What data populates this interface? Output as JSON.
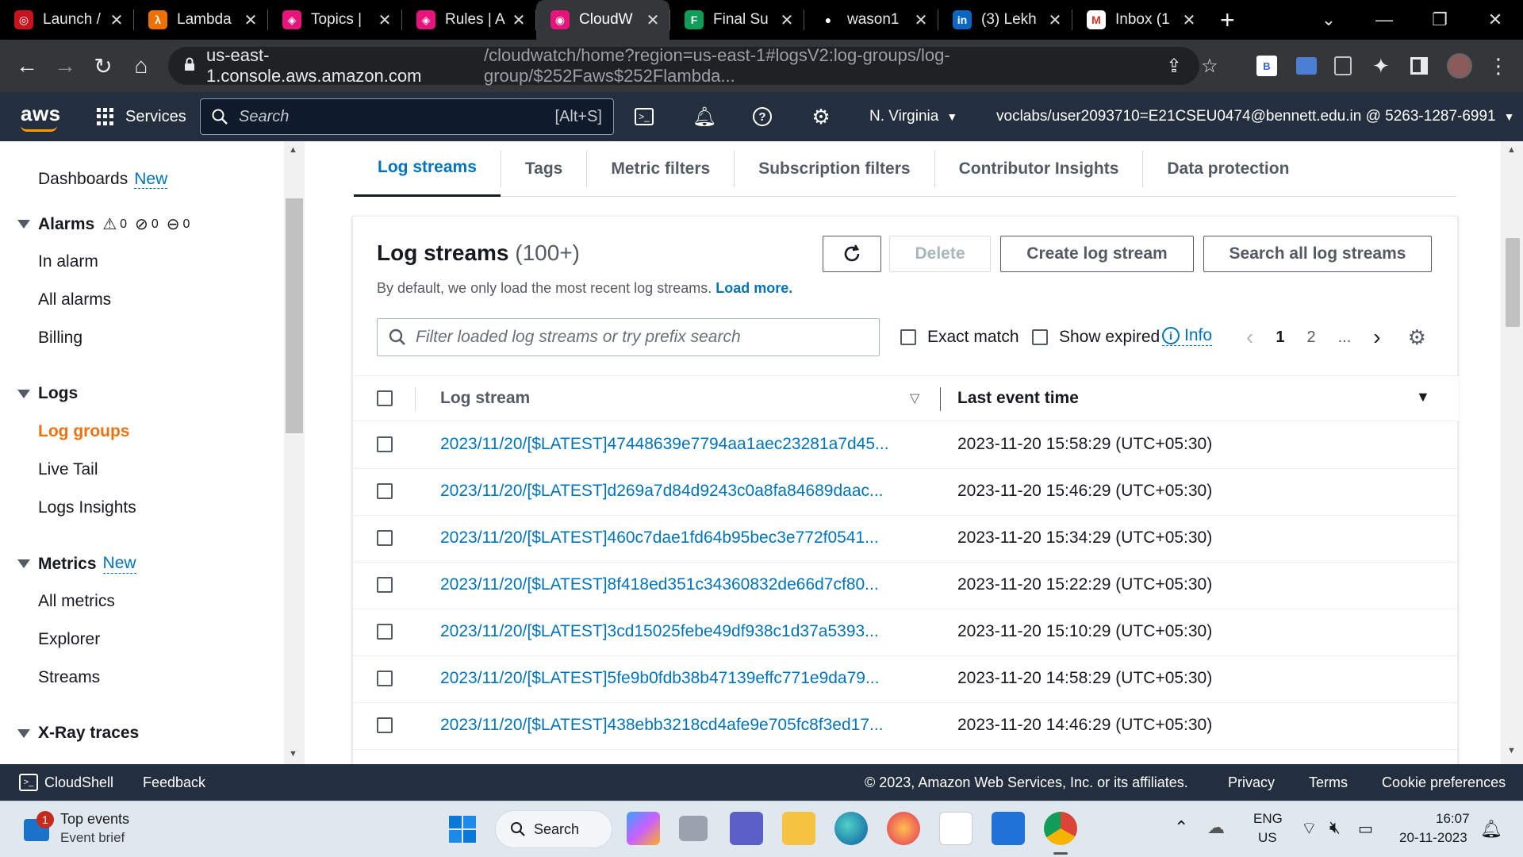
{
  "browser": {
    "tabs": [
      {
        "label": "Launch /",
        "color": "#c7131f",
        "glyph": "◎"
      },
      {
        "label": "Lambda",
        "color": "#ed7100",
        "glyph": "λ"
      },
      {
        "label": "Topics | ",
        "color": "#e7157b",
        "glyph": "◈"
      },
      {
        "label": "Rules | A",
        "color": "#e7157b",
        "glyph": "◈"
      },
      {
        "label": "CloudW",
        "color": "#e7157b",
        "glyph": "◉"
      },
      {
        "label": "Final Su",
        "color": "#0f9d58",
        "glyph": "F"
      },
      {
        "label": "wason1",
        "color": "#000000",
        "glyph": "●"
      },
      {
        "label": "(3) Lekh",
        "color": "#0a66c2",
        "glyph": "in"
      },
      {
        "label": "Inbox (1",
        "color": "#ffffff",
        "glyph": "M"
      }
    ],
    "active_tab_index": 4,
    "url_host": "us-east-1.console.aws.amazon.com",
    "url_path": "/cloudwatch/home?region=us-east-1#logsV2:log-groups/log-group/$252Faws$252Flambda..."
  },
  "aws_nav": {
    "logo": "aws",
    "services_label": "Services",
    "search_placeholder": "Search",
    "search_shortcut": "[Alt+S]",
    "region": "N. Virginia",
    "account": "voclabs/user2093710=E21CSEU0474@bennett.edu.in @ 5263-1287-6991"
  },
  "sidebar": {
    "dashboards": "Dashboards",
    "dashboards_badge": "New",
    "alarms": "Alarms",
    "alarm_counts": [
      "0",
      "0",
      "0"
    ],
    "alarm_items": [
      "In alarm",
      "All alarms",
      "Billing"
    ],
    "logs": "Logs",
    "log_items": [
      "Log groups",
      "Live Tail",
      "Logs Insights"
    ],
    "metrics": "Metrics",
    "metrics_badge": "New",
    "metric_items": [
      "All metrics",
      "Explorer",
      "Streams"
    ],
    "xray": "X-Ray traces"
  },
  "main": {
    "tabs": [
      "Log streams",
      "Tags",
      "Metric filters",
      "Subscription filters",
      "Contributor Insights",
      "Data protection"
    ],
    "panel_title": "Log streams",
    "panel_count": "(100+)",
    "description": "By default, we only load the most recent log streams.",
    "load_more": "Load more.",
    "buttons": {
      "delete": "Delete",
      "create": "Create log stream",
      "search_all": "Search all log streams"
    },
    "filter_placeholder": "Filter loaded log streams or try prefix search",
    "exact_match": "Exact match",
    "show_expired": "Show expired",
    "info": "Info",
    "pages": [
      "1",
      "2",
      "..."
    ],
    "columns": [
      "Log stream",
      "Last event time"
    ],
    "rows": [
      {
        "stream": "2023/11/20/[$LATEST]47448639e7794aa1aec23281a7d45...",
        "time": "2023-11-20 15:58:29 (UTC+05:30)"
      },
      {
        "stream": "2023/11/20/[$LATEST]d269a7d84d9243c0a8fa84689daac...",
        "time": "2023-11-20 15:46:29 (UTC+05:30)"
      },
      {
        "stream": "2023/11/20/[$LATEST]460c7dae1fd64b95bec3e772f0541...",
        "time": "2023-11-20 15:34:29 (UTC+05:30)"
      },
      {
        "stream": "2023/11/20/[$LATEST]8f418ed351c34360832de66d7cf80...",
        "time": "2023-11-20 15:22:29 (UTC+05:30)"
      },
      {
        "stream": "2023/11/20/[$LATEST]3cd15025febe49df938c1d37a5393...",
        "time": "2023-11-20 15:10:29 (UTC+05:30)"
      },
      {
        "stream": "2023/11/20/[$LATEST]5fe9b0fdb38b47139effc771e9da79...",
        "time": "2023-11-20 14:58:29 (UTC+05:30)"
      },
      {
        "stream": "2023/11/20/[$LATEST]438ebb3218cd4afe9e705fc8f3ed17...",
        "time": "2023-11-20 14:46:29 (UTC+05:30)"
      }
    ]
  },
  "footer": {
    "cloudshell": "CloudShell",
    "feedback": "Feedback",
    "copyright": "© 2023, Amazon Web Services, Inc. or its affiliates.",
    "privacy": "Privacy",
    "terms": "Terms",
    "cookies": "Cookie preferences"
  },
  "taskbar": {
    "widget_title": "Top events",
    "widget_sub": "Event brief",
    "widget_badge": "1",
    "search": "Search",
    "lang": "ENG",
    "region": "US",
    "time": "16:07",
    "date": "20-11-2023"
  }
}
